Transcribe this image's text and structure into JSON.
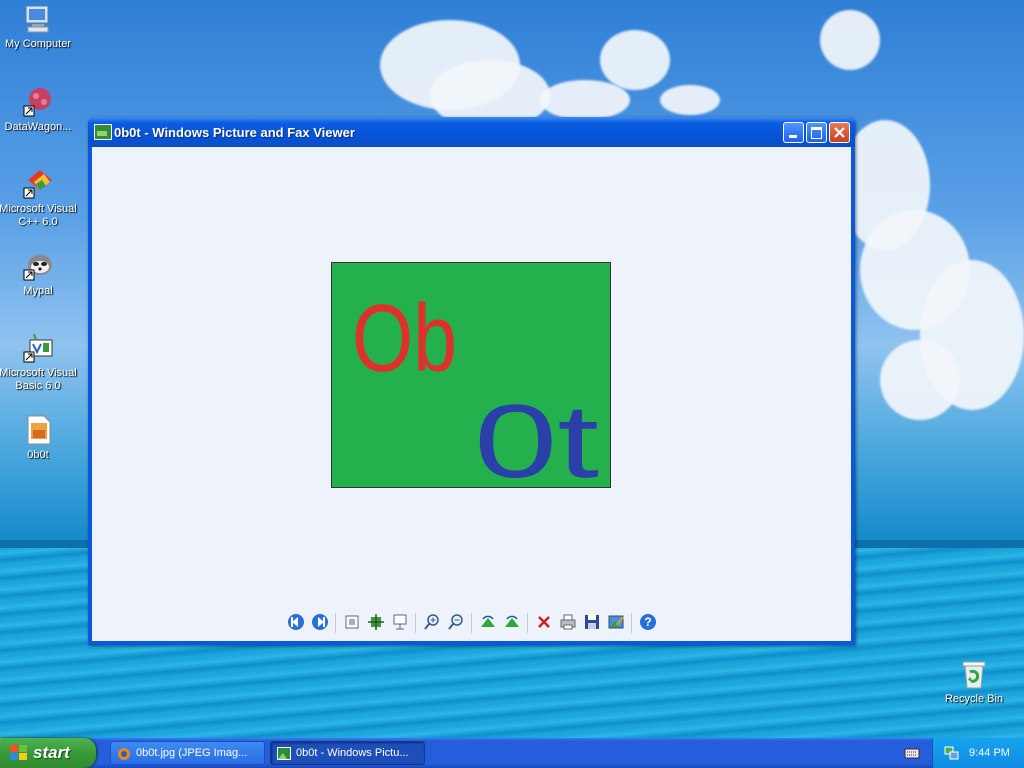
{
  "desktop": {
    "icons": [
      {
        "label_line1": "My Computer",
        "label_line2": ""
      },
      {
        "label_line1": "DataWagon...",
        "label_line2": ""
      },
      {
        "label_line1": "Microsoft Visual",
        "label_line2": "C++ 6.0"
      },
      {
        "label_line1": "Mypal",
        "label_line2": ""
      },
      {
        "label_line1": "Microsoft Visual",
        "label_line2": "Basic 6.0"
      },
      {
        "label_line1": "0b0t",
        "label_line2": ""
      },
      {
        "label_line1": "Recycle Bin",
        "label_line2": ""
      }
    ]
  },
  "window": {
    "title": "0b0t - Windows Picture and Fax Viewer",
    "image_text_line1": "Ob",
    "image_text_line2": "0t",
    "colors": {
      "image_bg": "#24b04c",
      "red_ink": "#e0302c",
      "blue_ink": "#2a3fa8"
    }
  },
  "taskbar": {
    "start_label": "start",
    "tasks": [
      {
        "label": "0b0t.jpg (JPEG Imag..."
      },
      {
        "label": "0b0t - Windows Pictu..."
      }
    ],
    "clock": "9:44 PM"
  }
}
